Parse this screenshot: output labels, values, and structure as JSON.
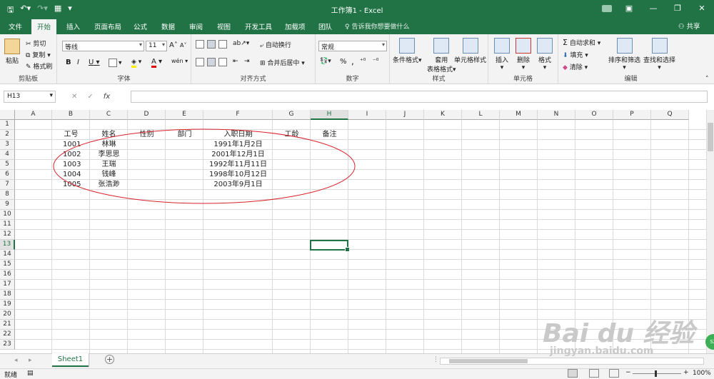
{
  "window": {
    "title": "工作簿1  -  Excel"
  },
  "tabs": [
    "文件",
    "开始",
    "插入",
    "页面布局",
    "公式",
    "数据",
    "审阅",
    "视图",
    "开发工具",
    "加载项",
    "团队"
  ],
  "tell_me": "告诉我你想要做什么",
  "share": "共享",
  "ribbon": {
    "clipboard": {
      "label": "剪贴板",
      "paste": "粘贴",
      "cut": "剪切",
      "copy": "复制",
      "format_painter": "格式刷"
    },
    "font": {
      "label": "字体",
      "name": "等线",
      "size": "11",
      "bold": "B",
      "italic": "I",
      "underline": "U",
      "grow": "A",
      "shrink": "A",
      "font_color": "A",
      "phonetic": "wén"
    },
    "alignment": {
      "label": "对齐方式",
      "wrap": "自动换行",
      "merge": "合并后居中"
    },
    "number": {
      "label": "数字",
      "format": "常规",
      "percent": "%",
      "comma": ","
    },
    "styles": {
      "label": "样式",
      "conditional": "条件格式",
      "as_table_1": "套用",
      "as_table_2": "表格格式",
      "cell_styles": "单元格样式"
    },
    "cells": {
      "label": "单元格",
      "insert": "插入",
      "delete": "删除",
      "format": "格式"
    },
    "editing": {
      "label": "编辑",
      "autosum": "自动求和",
      "fill": "填充",
      "clear": "清除",
      "sort": "排序和筛选",
      "find": "查找和选择"
    }
  },
  "formula_bar": {
    "name_box": "H13",
    "fx": "fx",
    "value": ""
  },
  "columns": [
    "A",
    "B",
    "C",
    "D",
    "E",
    "F",
    "G",
    "H",
    "I",
    "J",
    "K",
    "L",
    "M",
    "N",
    "O",
    "P",
    "Q"
  ],
  "rows": [
    "1",
    "2",
    "3",
    "4",
    "5",
    "6",
    "7",
    "8",
    "9",
    "10",
    "11",
    "12",
    "13",
    "14",
    "15",
    "16",
    "17",
    "18",
    "19",
    "20",
    "21",
    "22",
    "23"
  ],
  "selected_cell": "H13",
  "sheet": {
    "headers": [
      "工号",
      "姓名",
      "性别",
      "部门",
      "入职日期",
      "工龄",
      "备注"
    ],
    "data": [
      [
        "1001",
        "林琳",
        "1991年1月2日"
      ],
      [
        "1002",
        "李思思",
        "2001年12月1日"
      ],
      [
        "1003",
        "王瑞",
        "1992年11月11日"
      ],
      [
        "1004",
        "钱峰",
        "1998年10月12日"
      ],
      [
        "1005",
        "张浩渺",
        "2003年9月1日"
      ]
    ]
  },
  "sheet_tabs": [
    "Sheet1"
  ],
  "status": {
    "left": "就绪",
    "zoom": "100%"
  },
  "watermark": {
    "brand": "Bai du 经验",
    "url": "jingyan.baidu.com"
  },
  "colors": {
    "excel_green": "#217346",
    "annotation": "#d9232d"
  }
}
